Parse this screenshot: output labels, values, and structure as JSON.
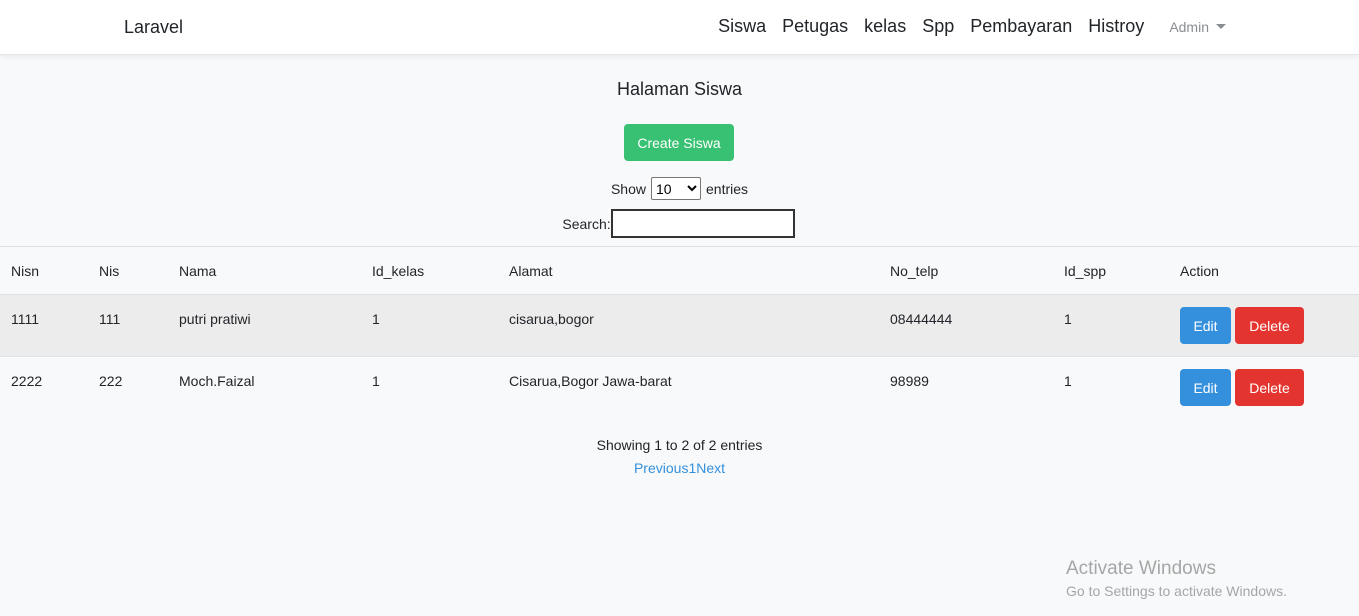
{
  "navbar": {
    "brand": "Laravel",
    "links": [
      "Siswa",
      "Petugas",
      "kelas",
      "Spp",
      "Pembayaran",
      "Histroy"
    ],
    "user": "Admin"
  },
  "page": {
    "title": "Halaman Siswa",
    "create_label": "Create Siswa"
  },
  "controls": {
    "show_label": "Show",
    "entries_value": "10",
    "entries_label": "entries",
    "search_label": "Search:"
  },
  "table": {
    "headers": [
      "Nisn",
      "Nis",
      "Nama",
      "Id_kelas",
      "Alamat",
      "No_telp",
      "Id_spp",
      "Action"
    ],
    "rows": [
      [
        "1111",
        "111",
        "putri pratiwi",
        "1",
        "cisarua,bogor",
        "08444444",
        "1"
      ],
      [
        "2222",
        "222",
        "Moch.Faizal",
        "1",
        "Cisarua,Bogor Jawa-barat",
        "98989",
        "1"
      ]
    ],
    "edit_label": "Edit",
    "delete_label": "Delete"
  },
  "footer": {
    "info": "Showing 1 to 2 of 2 entries",
    "prev": "Previous",
    "page": "1",
    "next": "Next"
  },
  "watermark": {
    "line1": "Activate Windows",
    "line2": "Go to Settings to activate Windows."
  },
  "colors": {
    "create": "#38c172",
    "edit": "#3490dc",
    "delete": "#e3342f",
    "link": "#3490dc"
  }
}
